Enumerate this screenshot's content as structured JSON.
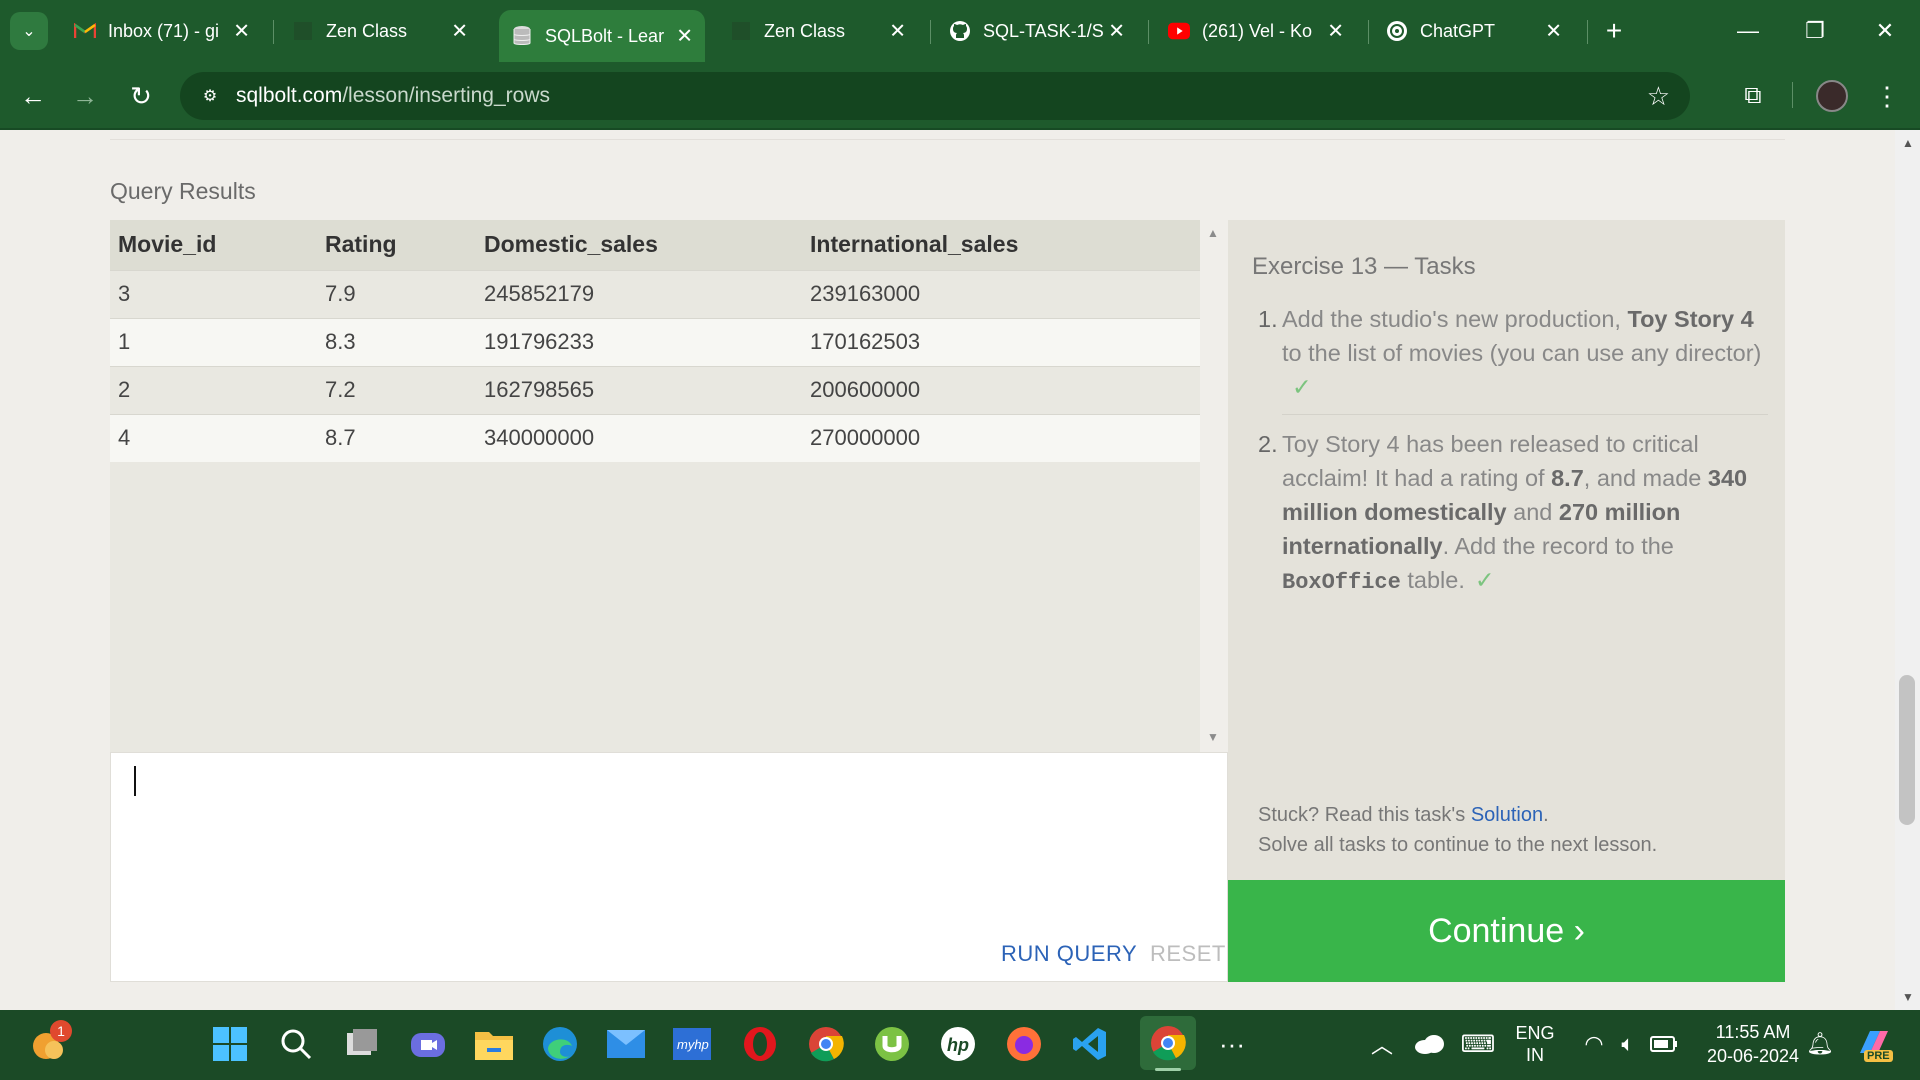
{
  "browser": {
    "tabs": [
      {
        "title": "Inbox (71) - gi",
        "icon": "gmail-icon"
      },
      {
        "title": "Zen Class",
        "icon": "zen-class-icon"
      },
      {
        "title": "SQLBolt - Lear",
        "icon": "database-icon",
        "active": true
      },
      {
        "title": "Zen Class",
        "icon": "zen-class-icon"
      },
      {
        "title": "SQL-TASK-1/S",
        "icon": "github-icon"
      },
      {
        "title": "(261) Vel - Ko",
        "icon": "youtube-icon"
      },
      {
        "title": "ChatGPT",
        "icon": "chatgpt-icon"
      }
    ],
    "url": {
      "host": "sqlbolt.com",
      "path": "/lesson/inserting_rows"
    }
  },
  "page": {
    "query_results_title": "Query Results",
    "table": {
      "headers": [
        "Movie_id",
        "Rating",
        "Domestic_sales",
        "International_sales"
      ],
      "rows": [
        [
          "3",
          "7.9",
          "245852179",
          "239163000"
        ],
        [
          "1",
          "8.3",
          "191796233",
          "170162503"
        ],
        [
          "2",
          "7.2",
          "162798565",
          "200600000"
        ],
        [
          "4",
          "8.7",
          "340000000",
          "270000000"
        ]
      ]
    },
    "editor": {
      "run_label": "RUN QUERY",
      "reset_label": "RESET"
    },
    "tasks": {
      "title": "Exercise 13 — Tasks",
      "items": [
        {
          "num": "1.",
          "parts": [
            "Add the studio's new production, ",
            "Toy Story 4",
            " to the list of movies (you can use any director)"
          ],
          "done_mark": "✓"
        },
        {
          "num": "2.",
          "parts": [
            "Toy Story 4 has been released to critical acclaim! It had a rating of ",
            "8.7",
            ", and made ",
            "340 million domestically",
            " and ",
            "270 million internationally",
            ". Add the record to the ",
            "BoxOffice",
            " table."
          ],
          "done_mark": "✓"
        }
      ],
      "stuck_prefix": "Stuck? Read this task's ",
      "solution_link": "Solution",
      "stuck_suffix": ".",
      "solve_all": "Solve all tasks to continue to the next lesson.",
      "continue_label": "Continue ›"
    }
  },
  "taskbar": {
    "notification_badge": "1",
    "lang_line1": "ENG",
    "lang_line2": "IN",
    "time": "11:55 AM",
    "date": "20-06-2024",
    "copilot_badge": "PRE"
  },
  "colors": {
    "chrome_green": "#1e5a2c",
    "continue_green": "#39b54a",
    "link_blue": "#2c63b7"
  }
}
